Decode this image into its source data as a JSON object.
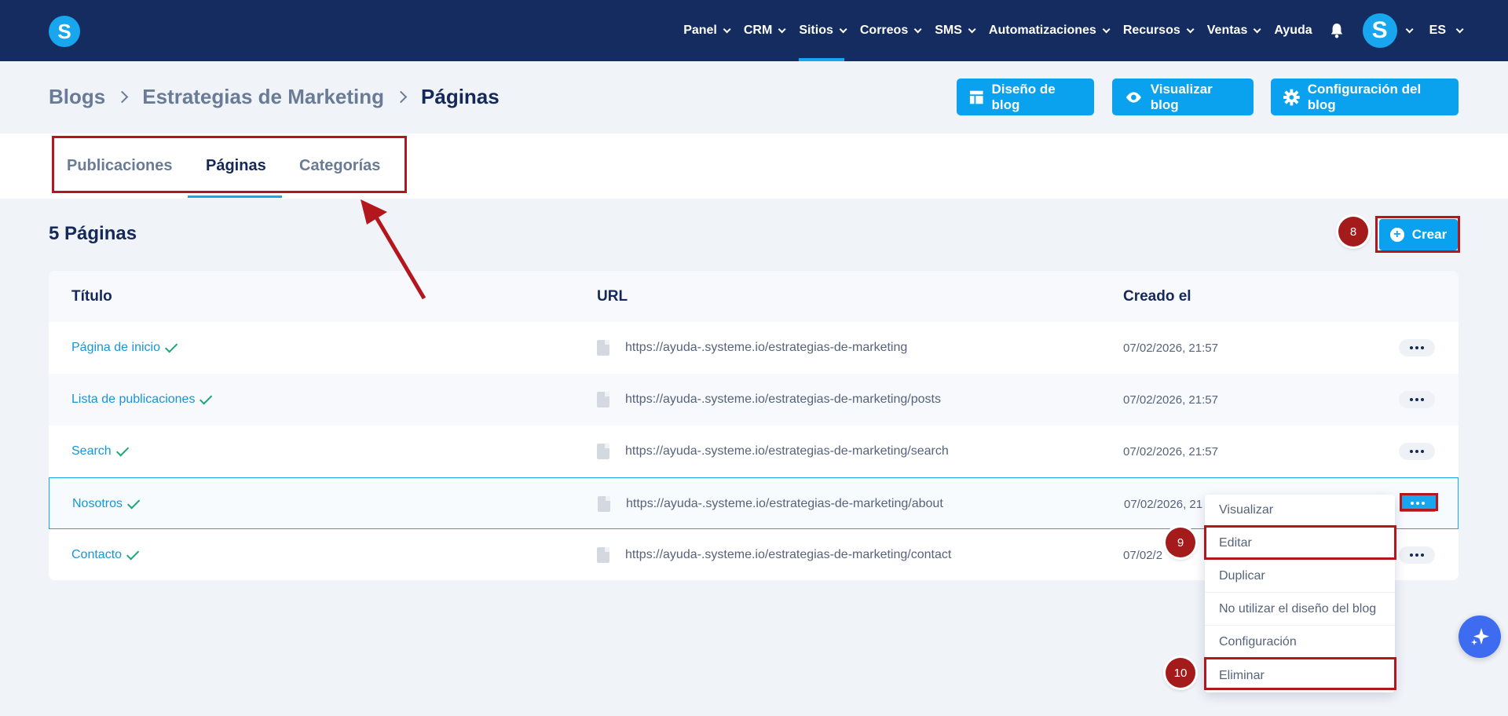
{
  "brand": {
    "logo_letter": "S"
  },
  "nav": {
    "items": [
      {
        "label": "Panel",
        "dropdown": true
      },
      {
        "label": "CRM",
        "dropdown": true
      },
      {
        "label": "Sitios",
        "dropdown": true,
        "active": true
      },
      {
        "label": "Correos",
        "dropdown": true
      },
      {
        "label": "SMS",
        "dropdown": true
      },
      {
        "label": "Automatizaciones",
        "dropdown": true
      },
      {
        "label": "Recursos",
        "dropdown": true
      },
      {
        "label": "Ventas",
        "dropdown": true
      },
      {
        "label": "Ayuda",
        "dropdown": false
      }
    ],
    "avatar_letter": "S",
    "language": "ES"
  },
  "breadcrumb": {
    "items": [
      "Blogs",
      "Estrategias de Marketing",
      "Páginas"
    ]
  },
  "header_buttons": {
    "layout": "Diseño de blog",
    "preview": "Visualizar blog",
    "settings": "Configuración del blog"
  },
  "tabs": [
    {
      "label": "Publicaciones",
      "active": false
    },
    {
      "label": "Páginas",
      "active": true
    },
    {
      "label": "Categorías",
      "active": false
    }
  ],
  "section": {
    "count_title": "5 Páginas",
    "create_label": "Crear"
  },
  "table": {
    "columns": [
      "Título",
      "URL",
      "Creado el"
    ],
    "rows": [
      {
        "title": "Página de inicio",
        "url": "https://ayuda-.systeme.io/estrategias-de-marketing",
        "created": "07/02/2026, 21:57"
      },
      {
        "title": "Lista de publicaciones",
        "url": "https://ayuda-.systeme.io/estrategias-de-marketing/posts",
        "created": "07/02/2026, 21:57"
      },
      {
        "title": "Search",
        "url": "https://ayuda-.systeme.io/estrategias-de-marketing/search",
        "created": "07/02/2026, 21:57"
      },
      {
        "title": "Nosotros",
        "url": "https://ayuda-.systeme.io/estrategias-de-marketing/about",
        "created": "07/02/2026, 21"
      },
      {
        "title": "Contacto",
        "url": "https://ayuda-.systeme.io/estrategias-de-marketing/contact",
        "created": "07/02/2"
      }
    ]
  },
  "dropdown_menu": {
    "items": [
      "Visualizar",
      "Editar",
      "Duplicar",
      "No utilizar el diseño del blog",
      "Configuración",
      "Eliminar"
    ]
  },
  "annotations": {
    "badges": [
      "8",
      "9",
      "10"
    ],
    "color": "#b3161d"
  },
  "colors": {
    "topbar": "#142c5f",
    "accent": "#0aa2ef",
    "link": "#1796d6",
    "check": "#1aa67a"
  }
}
